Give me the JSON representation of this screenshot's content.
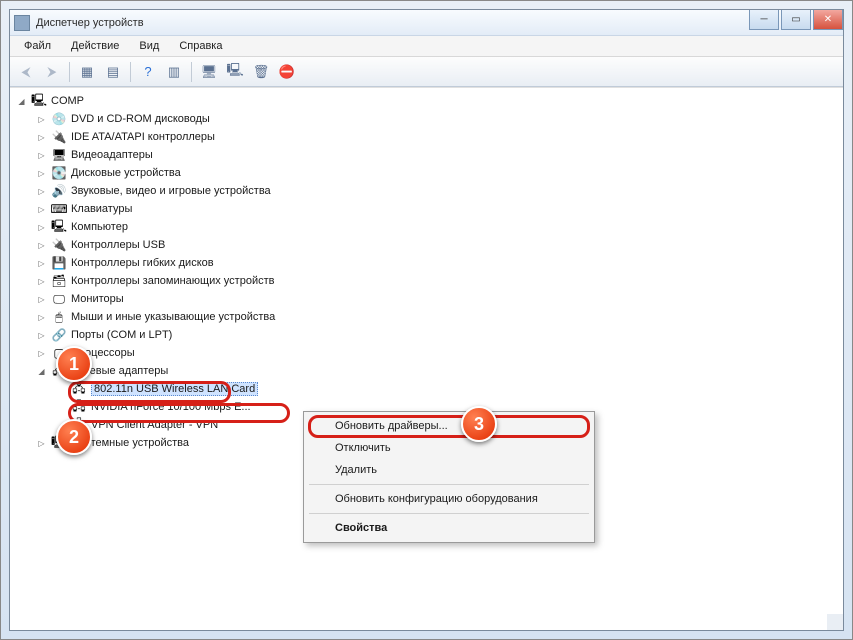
{
  "window": {
    "title": "Диспетчер устройств"
  },
  "menu": {
    "file": "Файл",
    "action": "Действие",
    "view": "Вид",
    "help": "Справка"
  },
  "tree": {
    "root": "COMP",
    "items": [
      "DVD и CD-ROM дисководы",
      "IDE ATA/ATAPI контроллеры",
      "Видеоадаптеры",
      "Дисковые устройства",
      "Звуковые, видео и игровые устройства",
      "Клавиатуры",
      "Компьютер",
      "Контроллеры USB",
      "Контроллеры гибких дисков",
      "Контроллеры запоминающих устройств",
      "Мониторы",
      "Мыши и иные указывающие устройства",
      "Порты (COM и LPT)",
      "Процессоры",
      "Сетевые адаптеры"
    ],
    "network_children": [
      "802.11n USB Wireless LAN Card",
      "NVIDIA nForce 10/100 Mbps E...",
      "VPN Client Adapter - VPN"
    ],
    "after": "Системные устройства"
  },
  "context_menu": {
    "update": "Обновить драйверы...",
    "disable": "Отключить",
    "delete": "Удалить",
    "refresh": "Обновить конфигурацию оборудования",
    "props": "Свойства"
  },
  "callouts": {
    "c1": "1",
    "c2": "2",
    "c3": "3"
  },
  "icons": {
    "dvd": "💿",
    "ide": "🔌",
    "video": "🖥",
    "disk": "💽",
    "audio": "🔊",
    "kbd": "⌨",
    "pc": "🖳",
    "usb": "🔌",
    "floppy": "💾",
    "storage": "🗃",
    "monitor": "🖵",
    "mouse": "🖱",
    "port": "🔗",
    "cpu": "▢",
    "net": "🖧",
    "sys": "🖳",
    "adapter": "🖧",
    "comp": "🖳"
  }
}
